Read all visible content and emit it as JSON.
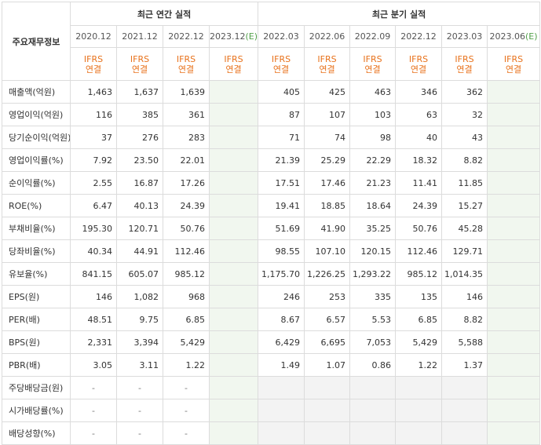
{
  "table": {
    "row_header_label": "주요재무정보",
    "groups": {
      "annual": "최근 연간 실적",
      "quarterly": "최근 분기 실적"
    },
    "periods": [
      {
        "label": "2020.12",
        "mark": ""
      },
      {
        "label": "2021.12",
        "mark": ""
      },
      {
        "label": "2022.12",
        "mark": ""
      },
      {
        "label": "2023.12",
        "mark": "(E)"
      },
      {
        "label": "2022.03",
        "mark": ""
      },
      {
        "label": "2022.06",
        "mark": ""
      },
      {
        "label": "2022.09",
        "mark": ""
      },
      {
        "label": "2022.12",
        "mark": ""
      },
      {
        "label": "2023.03",
        "mark": ""
      },
      {
        "label": "2023.06",
        "mark": "(E)"
      }
    ],
    "accounting": {
      "line1": "IFRS",
      "line2": "연결"
    },
    "rows": [
      {
        "label": "매출액(억원)",
        "values": [
          "1,463",
          "1,637",
          "1,639",
          "",
          "405",
          "425",
          "463",
          "346",
          "362",
          ""
        ]
      },
      {
        "label": "영업이익(억원)",
        "values": [
          "116",
          "385",
          "361",
          "",
          "87",
          "107",
          "103",
          "63",
          "32",
          ""
        ]
      },
      {
        "label": "당기순이익(억원)",
        "values": [
          "37",
          "276",
          "283",
          "",
          "71",
          "74",
          "98",
          "40",
          "43",
          ""
        ]
      },
      {
        "label": "영업이익률(%)",
        "values": [
          "7.92",
          "23.50",
          "22.01",
          "",
          "21.39",
          "25.29",
          "22.29",
          "18.32",
          "8.82",
          ""
        ]
      },
      {
        "label": "순이익률(%)",
        "values": [
          "2.55",
          "16.87",
          "17.26",
          "",
          "17.51",
          "17.46",
          "21.23",
          "11.41",
          "11.85",
          ""
        ]
      },
      {
        "label": "ROE(%)",
        "values": [
          "6.47",
          "40.13",
          "24.39",
          "",
          "19.41",
          "18.85",
          "18.64",
          "24.39",
          "15.27",
          ""
        ]
      },
      {
        "label": "부채비율(%)",
        "values": [
          "195.30",
          "120.71",
          "50.76",
          "",
          "51.69",
          "41.90",
          "35.25",
          "50.76",
          "45.28",
          ""
        ]
      },
      {
        "label": "당좌비율(%)",
        "values": [
          "40.34",
          "44.91",
          "112.46",
          "",
          "98.55",
          "107.10",
          "120.15",
          "112.46",
          "129.71",
          ""
        ]
      },
      {
        "label": "유보율(%)",
        "values": [
          "841.15",
          "605.07",
          "985.12",
          "",
          "1,175.70",
          "1,226.25",
          "1,293.22",
          "985.12",
          "1,014.35",
          ""
        ]
      },
      {
        "label": "EPS(원)",
        "values": [
          "146",
          "1,082",
          "968",
          "",
          "246",
          "253",
          "335",
          "135",
          "146",
          ""
        ]
      },
      {
        "label": "PER(배)",
        "values": [
          "48.51",
          "9.75",
          "6.85",
          "",
          "8.67",
          "6.57",
          "5.53",
          "6.85",
          "8.82",
          ""
        ]
      },
      {
        "label": "BPS(원)",
        "values": [
          "2,331",
          "3,394",
          "5,429",
          "",
          "6,429",
          "6,695",
          "7,053",
          "5,429",
          "5,588",
          ""
        ]
      },
      {
        "label": "PBR(배)",
        "values": [
          "3.05",
          "3.11",
          "1.22",
          "",
          "1.49",
          "1.07",
          "0.86",
          "1.22",
          "1.37",
          ""
        ]
      },
      {
        "label": "주당배당금(원)",
        "values": [
          "-",
          "-",
          "-",
          "",
          "",
          "",
          "",
          "",
          "",
          ""
        ]
      },
      {
        "label": "시가배당률(%)",
        "values": [
          "-",
          "-",
          "-",
          "",
          "",
          "",
          "",
          "",
          "",
          ""
        ]
      },
      {
        "label": "배당성향(%)",
        "values": [
          "-",
          "-",
          "-",
          "",
          "",
          "",
          "",
          "",
          "",
          ""
        ]
      }
    ]
  },
  "colors": {
    "accent_orange": "#e8721c",
    "estimate_green": "#52a14a",
    "estimate_bg": "#f1f7ef",
    "nodata_bg": "#f3f3f3"
  }
}
